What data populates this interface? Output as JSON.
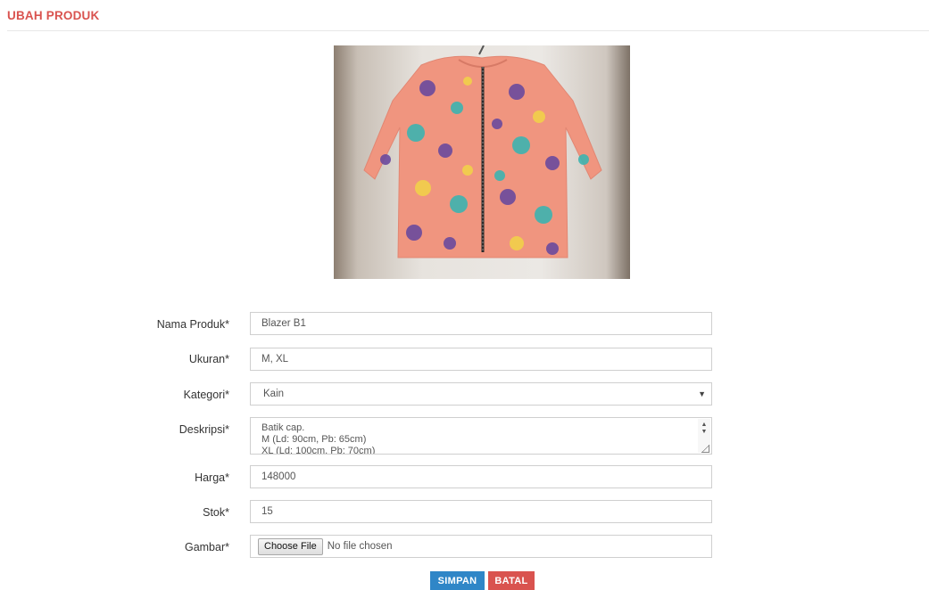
{
  "page": {
    "title": "UBAH PRODUK"
  },
  "product_image": {
    "alt": "Blazer B1 batik"
  },
  "form": {
    "name": {
      "label": "Nama Produk*",
      "value": "Blazer B1"
    },
    "size": {
      "label": "Ukuran*",
      "value": "M, XL"
    },
    "category": {
      "label": "Kategori*",
      "value": "Kain"
    },
    "description": {
      "label": "Deskripsi*",
      "lines": [
        "Batik cap.",
        "M (Ld: 90cm, Pb: 65cm)",
        "XL (Ld: 100cm, Pb: 70cm)"
      ]
    },
    "price": {
      "label": "Harga*",
      "value": "148000"
    },
    "stock": {
      "label": "Stok*",
      "value": "15"
    },
    "image": {
      "label": "Gambar*",
      "button": "Choose File",
      "status": "No file chosen"
    }
  },
  "actions": {
    "save": "SIMPAN",
    "cancel": "BATAL"
  },
  "colors": {
    "title": "#d9534f",
    "save": "#2f86c7",
    "cancel": "#d9534f"
  },
  "icons": {
    "select": "chevron-down-icon",
    "textarea_scroll": "spinner-icon",
    "textarea_resize": "resize-grip-icon"
  }
}
